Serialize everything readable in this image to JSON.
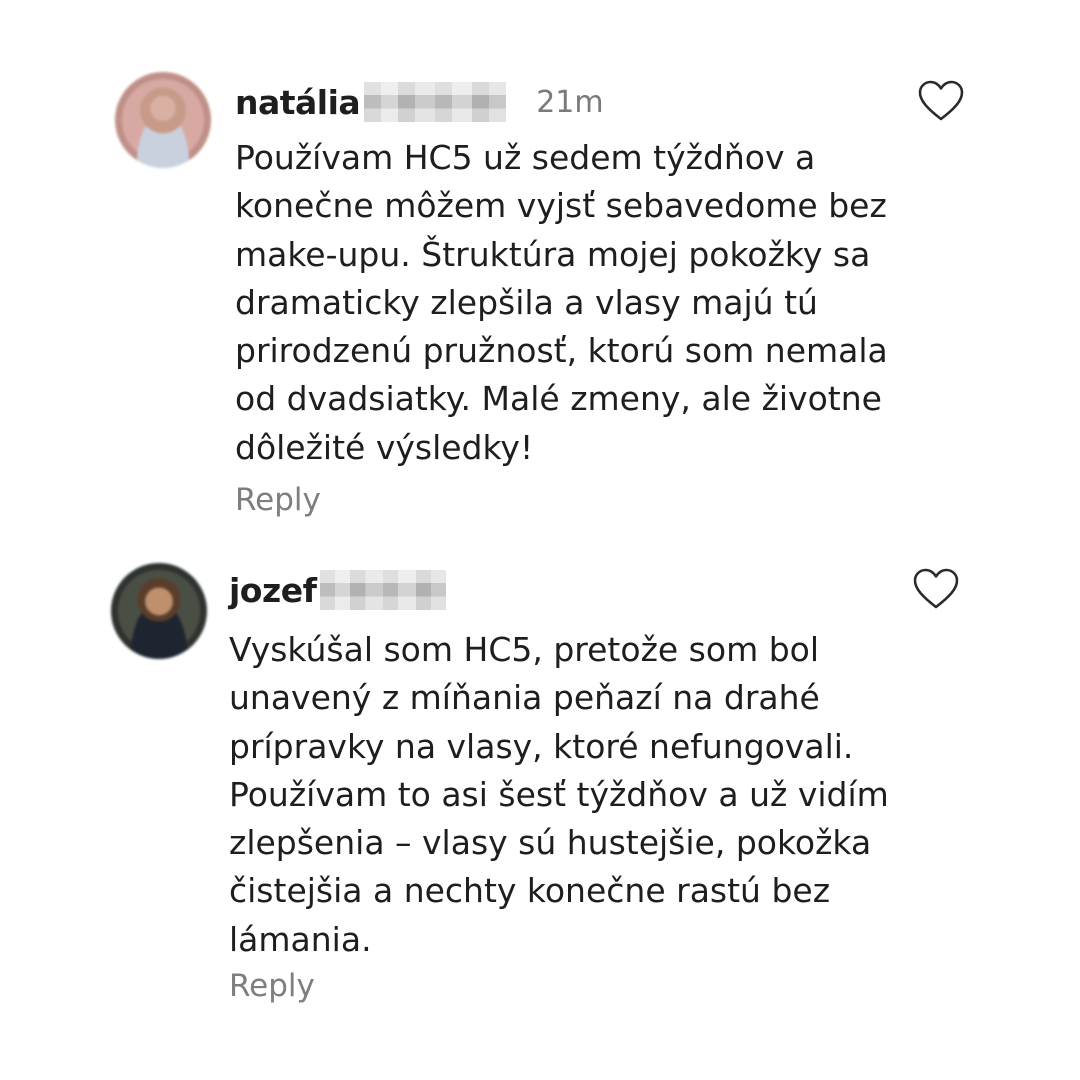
{
  "comments": [
    {
      "username": "natália",
      "timestamp": "21m",
      "lines": [
        "Používam HC5 už sedem týždňov a",
        "konečne môžem vyjsť sebavedome bez",
        "make-upu. Štruktúra mojej pokožky sa",
        "dramaticky zlepšila a vlasy majú tú",
        "prirodzenú pružnosť, ktorú som nemala",
        "od dvadsiatky. Malé zmeny, ale životne",
        "dôležité výsledky!"
      ],
      "reply_label": "Reply",
      "avatar_icon": "profile-photo",
      "like_icon": "heart-outline-icon"
    },
    {
      "username": "jozef",
      "lines": [
        "Vyskúšal som HC5, pretože som bol",
        "unavený z míňania peňazí na drahé",
        "prípravky na vlasy, ktoré nefungovali.",
        "Používam to asi šesť týždňov a už vidím",
        "zlepšenia – vlasy sú hustejšie, pokožka",
        "čistejšia a nechty konečne rastú bez",
        "lámania."
      ],
      "reply_label": "Reply",
      "avatar_icon": "profile-photo",
      "like_icon": "heart-outline-icon"
    }
  ],
  "colors": {
    "text": "#1e1e1e",
    "muted": "#7a7a7a",
    "background": "#ffffff"
  }
}
